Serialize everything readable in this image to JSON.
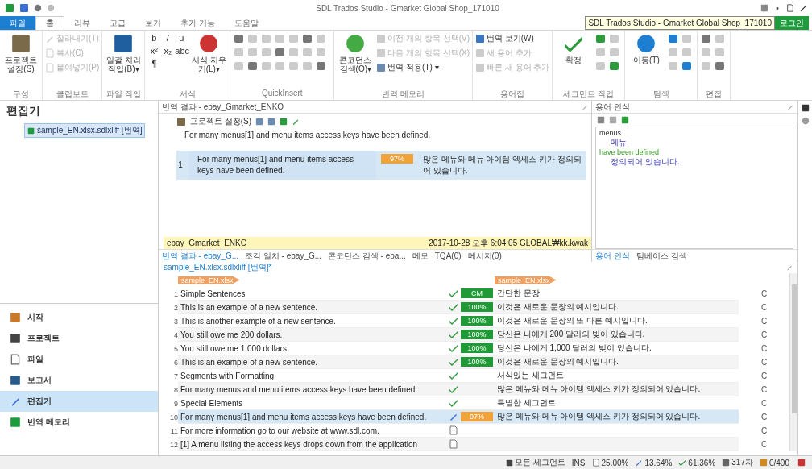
{
  "window": {
    "title": "SDL Trados Studio - Gmarket Global Shop_171010",
    "tooltip": "SDL Trados Studio - Gmarket Global Shop_171010",
    "login": "로그인"
  },
  "tabs": [
    {
      "label": "파일",
      "selected": false,
      "kind": "file"
    },
    {
      "label": "홈",
      "selected": true,
      "kind": "tab"
    },
    {
      "label": "리뷰",
      "selected": false,
      "kind": "tab"
    },
    {
      "label": "고급",
      "selected": false,
      "kind": "tab"
    },
    {
      "label": "보기",
      "selected": false,
      "kind": "tab"
    },
    {
      "label": "추가 기능",
      "selected": false,
      "kind": "tab"
    },
    {
      "label": "도움말",
      "selected": false,
      "kind": "tab"
    }
  ],
  "ribbon": [
    {
      "label": "구성",
      "items": [
        {
          "kind": "large",
          "label": "프로젝트 설정(S)",
          "disabled": false
        }
      ]
    },
    {
      "label": "클립보드",
      "items": [
        {
          "kind": "small",
          "label": "잘라내기(T)",
          "disabled": true
        },
        {
          "kind": "small",
          "label": "복사(C)",
          "disabled": true
        },
        {
          "kind": "small",
          "label": "붙여넣기(P)",
          "disabled": true
        }
      ]
    },
    {
      "label": "파일 작업",
      "items": [
        {
          "kind": "large",
          "label": "일괄 처리 작업(B)▾",
          "disabled": false
        }
      ]
    },
    {
      "label": "서식",
      "items": [
        {
          "kind": "glyphs",
          "glyphs": [
            "b",
            "/",
            "u",
            "x²",
            "x₂",
            "abc",
            "¶"
          ]
        },
        {
          "kind": "large",
          "label": "서식 지우기(L)▾",
          "disabled": false
        }
      ]
    },
    {
      "label": "QuickInsert",
      "items": [
        {
          "kind": "grid",
          "disabled": false
        }
      ]
    },
    {
      "label": "번역 메모리",
      "items": [
        {
          "kind": "large",
          "label": "콘코던스 검색(O)▾",
          "disabled": false
        },
        {
          "kind": "small",
          "label": "이전 개의 항목 선택(V)",
          "disabled": true
        },
        {
          "kind": "small",
          "label": "다음 개의 항목 선택(X)",
          "disabled": true
        },
        {
          "kind": "small",
          "label": "번역 적용(T) ▾",
          "disabled": false
        }
      ]
    },
    {
      "label": "용어집",
      "items": [
        {
          "kind": "small",
          "label": "번역 보기(W)",
          "disabled": false
        },
        {
          "kind": "small",
          "label": "새 용어 추가",
          "disabled": true
        },
        {
          "kind": "small",
          "label": "빠른 새 용어 추가",
          "disabled": true
        }
      ]
    },
    {
      "label": "세그먼트 작업",
      "items": [
        {
          "kind": "large",
          "label": "확정",
          "disabled": false
        },
        {
          "kind": "grid",
          "disabled": false
        }
      ]
    },
    {
      "label": "탐색",
      "items": [
        {
          "kind": "large",
          "label": "이동(T)",
          "disabled": false
        },
        {
          "kind": "grid",
          "disabled": false
        }
      ]
    },
    {
      "label": "편집",
      "items": [
        {
          "kind": "grid",
          "disabled": false
        }
      ]
    }
  ],
  "navigation": {
    "title": "편집기",
    "file": "sample_EN.xlsx.sdlxliff [번역]",
    "items": [
      {
        "label": "시작",
        "selected": false
      },
      {
        "label": "프로젝트",
        "selected": false
      },
      {
        "label": "파일",
        "selected": false
      },
      {
        "label": "보고서",
        "selected": false
      },
      {
        "label": "편집기",
        "selected": true
      },
      {
        "label": "번역 메모리",
        "selected": false
      }
    ]
  },
  "translation_results": {
    "title": "번역 결과 - ebay_Gmarket_ENKO",
    "toolbar_label": "프로젝트 설정(S)",
    "source": "For many menus[1] and menu items access keys have been defined.",
    "result": {
      "number": "1",
      "source": "For many menus[1] and menu items access keys have been defined.",
      "match": "97%",
      "target": "많은 메뉴와 메뉴 아이템 엑세스 키가 정의되어 있습니다."
    },
    "footer_tm": "ebay_Gmarket_ENKO",
    "footer_info": "2017-10-28 오후 6:04:05 GLOBAL₩kk.kwak"
  },
  "termbase": {
    "title": "용어 인식",
    "entries": [
      {
        "source": "menus",
        "target": "메뉴",
        "kind": "plain"
      },
      {
        "source": "have been defined",
        "target": "정의되어 있습니다.",
        "kind": "phrase"
      }
    ]
  },
  "pane_tabs": [
    {
      "label": "번역 결과 - ebay_G...",
      "selected": true
    },
    {
      "label": "조각 일치 - ebay_G...",
      "selected": false
    },
    {
      "label": "콘코던스 검색 - eba...",
      "selected": false
    },
    {
      "label": "메모",
      "selected": false
    },
    {
      "label": "TQA(0)",
      "selected": false
    },
    {
      "label": "메시지(0)",
      "selected": false
    }
  ],
  "term_tabs": [
    {
      "label": "용어 인식",
      "selected": true
    },
    {
      "label": "텀베이스 검색",
      "selected": false
    }
  ],
  "editor": {
    "tab": "sample_EN.xlsx.sdlxliff [번역]*",
    "source_file": "sample_EN.xlsx",
    "target_file": "sample_EN.xlsx",
    "rows": [
      {
        "number": "1",
        "source": "Simple Sentences",
        "kind": "confirmed",
        "match": "CM",
        "color": "#1f9a36",
        "target": "간단한 문장",
        "lock": "C",
        "selected": false
      },
      {
        "number": "2",
        "source": "This is an example of a new sentence.",
        "kind": "confirmed",
        "match": "100%",
        "color": "#1f9a36",
        "target": "이것은 새로운 문장의 예시입니다.",
        "lock": "C",
        "selected": false
      },
      {
        "number": "3",
        "source": "This is another example of a new sentence.",
        "kind": "confirmed",
        "match": "100%",
        "color": "#1f9a36",
        "target": "이것은 새로운 문장의 또 다른 예시입니다.",
        "lock": "C",
        "selected": false
      },
      {
        "number": "4",
        "source": "You still owe me 200 dollars.",
        "kind": "confirmed",
        "match": "100%",
        "color": "#1f9a36",
        "target": "당신은 나에게 200 달러의 빚이 있습니다.",
        "lock": "C",
        "selected": false
      },
      {
        "number": "5",
        "source": "You still owe me 1,000 dollars.",
        "kind": "confirmed",
        "match": "100%",
        "color": "#1f9a36",
        "target": "당신은 나에게 1,000 달러의 빚이 있습니다.",
        "lock": "C",
        "selected": false
      },
      {
        "number": "6",
        "source": "This is an example of a new sentence.",
        "kind": "confirmed",
        "match": "100%",
        "color": "#1f9a36",
        "target": "이것은 새로운 문장의 예시입니다.",
        "lock": "C",
        "selected": false
      },
      {
        "number": "7",
        "source": "Segments with Formatting",
        "kind": "confirmed",
        "target": "서식있는 세그먼트",
        "lock": "C",
        "selected": false
      },
      {
        "number": "8",
        "source": "For many menus and menu items access keys have been defined.",
        "kind": "confirmed",
        "target": "많은 메뉴와 메뉴 아이템 엑세스 키가 정의되어 있습니다.",
        "lock": "C",
        "selected": false
      },
      {
        "number": "9",
        "source": "Special Elements",
        "kind": "confirmed",
        "target": "특별한 세그먼트",
        "lock": "C",
        "selected": false
      },
      {
        "number": "10",
        "source": "For many menus[1] and menu items access keys have been defined.",
        "kind": "draft",
        "match": "97%",
        "color": "#f1a339",
        "target": "많은 메뉴와 메뉴 아이템 엑세스 키가 정의되어 있습니다.",
        "lock": "C",
        "selected": true
      },
      {
        "number": "11",
        "source": "For more information go to our website at www.sdl.com.",
        "kind": "empty",
        "lock": "C",
        "selected": false
      },
      {
        "number": "12",
        "source": "[1] A menu listing the access keys drops down from the application",
        "kind": "empty",
        "lock": "C",
        "selected": false
      }
    ]
  },
  "status_bar": {
    "filter": "모든 세그먼트",
    "mode": "INS",
    "stats": [
      "25.00%",
      "13.64%",
      "61.36%",
      "317자",
      "0/400"
    ]
  }
}
